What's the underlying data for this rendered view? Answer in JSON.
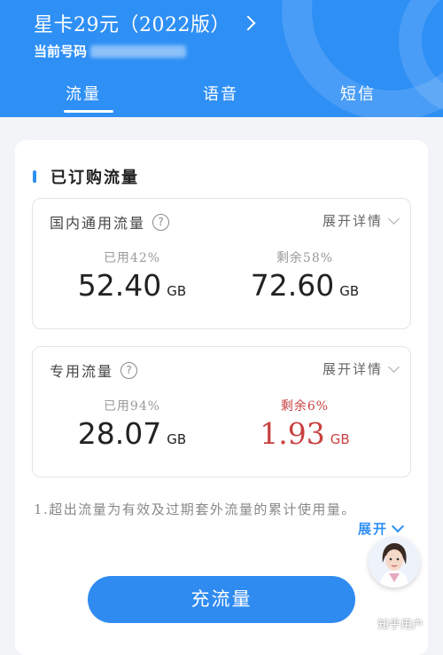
{
  "header": {
    "plan_title": "星卡29元（2022版）",
    "number_label": "当前号码",
    "tabs": [
      {
        "label": "流量",
        "active": true
      },
      {
        "label": "语音",
        "active": false
      },
      {
        "label": "短信",
        "active": false
      }
    ]
  },
  "section": {
    "title": "已订购流量"
  },
  "packages": [
    {
      "title": "国内通用流量",
      "expand_label": "展开详情",
      "used_label": "已用42%",
      "used_value": "52.40",
      "remaining_label": "剩余58%",
      "remaining_value": "72.60",
      "unit": "GB"
    },
    {
      "title": "专用流量",
      "expand_label": "展开详情",
      "used_label": "已用94%",
      "used_value": "28.07",
      "remaining_label": "剩余6%",
      "remaining_value": "1.93",
      "unit": "GB"
    }
  ],
  "note": {
    "text": "1.超出流量为有效及过期套外流量的累计使用量。",
    "expand_label": "展开"
  },
  "cta_label": "充流量",
  "watermark": "知乎用户",
  "colors": {
    "brand_blue": "#2e8ff5",
    "warning_red": "#c94141"
  }
}
